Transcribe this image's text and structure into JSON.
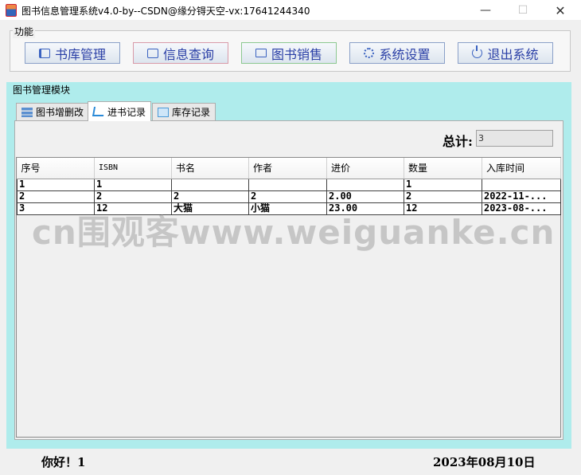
{
  "window": {
    "title": "图书信息管理系统v4.0-by--CSDN@缘分锝天空-vx:17641244340",
    "minimize": "—",
    "maximize": "☐",
    "close": "✕"
  },
  "function_panel": {
    "legend": "功能",
    "buttons": [
      {
        "label": "书库管理",
        "icon": "book-icon"
      },
      {
        "label": "信息查询",
        "icon": "search-icon"
      },
      {
        "label": "图书销售",
        "icon": "sale-icon"
      },
      {
        "label": "系统设置",
        "icon": "gear-icon"
      },
      {
        "label": "退出系统",
        "icon": "power-icon"
      }
    ]
  },
  "module": {
    "title": "图书管理模块",
    "tabs": [
      {
        "label": "图书增删改",
        "icon": "stack-icon"
      },
      {
        "label": "进书记录",
        "icon": "cart-icon"
      },
      {
        "label": "库存记录",
        "icon": "box-icon"
      }
    ],
    "active_tab": 1
  },
  "total": {
    "label": "总计:",
    "value": "3"
  },
  "table": {
    "columns": [
      "序号",
      "ISBN",
      "书名",
      "作者",
      "进价",
      "数量",
      "入库时间"
    ],
    "rows": [
      [
        "1",
        "1",
        "",
        "",
        "",
        "1",
        ""
      ],
      [
        "2",
        "2",
        "2",
        "2",
        "2.00",
        "2",
        "2022-11-..."
      ],
      [
        "3",
        "12",
        "大猫",
        "小猫",
        "23.00",
        "12",
        "2023-08-..."
      ]
    ]
  },
  "watermark": "cn围观客www.weiguanke.cn",
  "status": {
    "greeting": "你好！1",
    "date": "2023年08月10日"
  }
}
